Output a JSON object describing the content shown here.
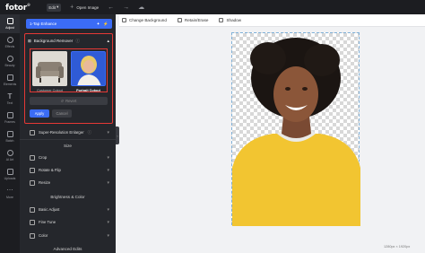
{
  "app": {
    "logo": "fotor",
    "edit_label": "Edit",
    "open_image": "Open Image"
  },
  "rail": [
    {
      "label": "Adjust",
      "icon": "adjust-icon",
      "active": true
    },
    {
      "label": "Effects",
      "icon": "effects-icon"
    },
    {
      "label": "Beauty",
      "icon": "beauty-icon"
    },
    {
      "label": "Elements",
      "icon": "elements-icon"
    },
    {
      "label": "Text",
      "icon": "text-icon"
    },
    {
      "label": "Frames",
      "icon": "frames-icon"
    },
    {
      "label": "Batch",
      "icon": "batch-icon"
    },
    {
      "label": "AI Art",
      "icon": "ai-art-icon"
    },
    {
      "label": "Uploads",
      "icon": "uploads-icon"
    },
    {
      "label": "More",
      "icon": "more-icon"
    }
  ],
  "panel": {
    "enhance": "1-Tap Enhance",
    "bg_remover": {
      "title": "Background Remover",
      "customer_cutout": "Customer Cutout",
      "portrait_cutout": "Portrait Cutout",
      "revert": "Revert",
      "apply": "Apply",
      "cancel": "Cancel"
    },
    "super_resolution": "Super-Resolution Enlarger",
    "section_size": "Size",
    "crop": "Crop",
    "rotate_flip": "Rotate & Flip",
    "resize": "Resize",
    "section_brightness": "Brightness & Color",
    "basic_adjust": "Basic Adjust",
    "fine_tune": "Fine Tune",
    "color": "Color",
    "section_advanced": "Advanced Edits"
  },
  "toolbar": {
    "change_background": "Change Background",
    "retain_erase": "Retain/Erase",
    "shadow": "Shadow"
  },
  "canvas": {
    "zoom_info": "1280px × 1920px"
  },
  "colors": {
    "accent": "#3b6cf6",
    "highlight": "#e53935",
    "panel": "#25272c"
  }
}
